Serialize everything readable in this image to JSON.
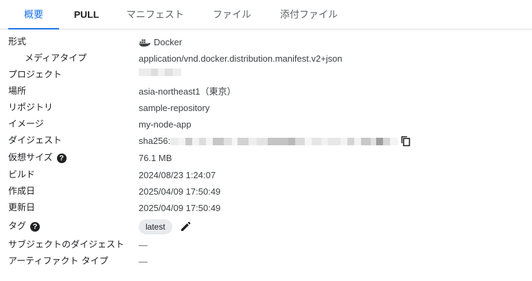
{
  "tabs": [
    {
      "label": "概要",
      "active": true
    },
    {
      "label": "PULL",
      "active": false
    },
    {
      "label": "マニフェスト",
      "active": false
    },
    {
      "label": "ファイル",
      "active": false
    },
    {
      "label": "添付ファイル",
      "active": false
    }
  ],
  "details": {
    "format_label": "形式",
    "format_value": "Docker",
    "media_type_label": "メディアタイプ",
    "media_type_value": "application/vnd.docker.distribution.manifest.v2+json",
    "project_label": "プロジェクト",
    "location_label": "場所",
    "location_value": "asia-northeast1（東京）",
    "repository_label": "リポジトリ",
    "repository_value": "sample-repository",
    "image_label": "イメージ",
    "image_value": "my-node-app",
    "digest_label": "ダイジェスト",
    "digest_prefix": "sha256:",
    "virtual_size_label": "仮想サイズ",
    "virtual_size_value": "76.1 MB",
    "build_label": "ビルド",
    "build_value": "2024/08/23 1:24:07",
    "created_label": "作成日",
    "created_value": "2025/04/09 17:50:49",
    "updated_label": "更新日",
    "updated_value": "2025/04/09 17:50:49",
    "tags_label": "タグ",
    "tag_value": "latest",
    "subject_digest_label": "サブジェクトのダイジェスト",
    "subject_digest_value": "—",
    "artifact_type_label": "アーティファクト タイプ",
    "artifact_type_value": "—",
    "help_glyph": "?"
  },
  "colors": {
    "accent": "#1a73e8",
    "chip_bg": "#e8eaed",
    "divider": "#dadce0"
  }
}
